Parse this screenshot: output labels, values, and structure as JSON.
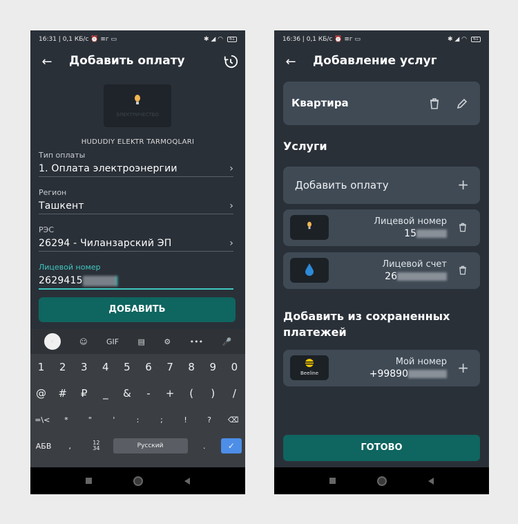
{
  "left": {
    "status": {
      "time": "16:31 | 0,1 КБ/с ⏰ ≡г ▭",
      "icons": "✱ ◢ ◠",
      "battery": "61"
    },
    "title": "Добавить оплату",
    "logo_text": "ЭЛЕКТРИЧЕСТВО",
    "company": "HUDUDIY ELEKTR TARMOQLARI",
    "fields": [
      {
        "label": "Тип оплаты",
        "value": "1. Оплата электроэнергии"
      },
      {
        "label": "Регион",
        "value": "Ташкент"
      },
      {
        "label": "РЭС",
        "value": "26294 - Чиланзарский ЭП"
      },
      {
        "label": "Лицевой номер",
        "value": "2629415"
      }
    ],
    "add_button": "ДОБАВИТЬ",
    "keyboard": {
      "toolbar": [
        "‹",
        "☺",
        "GIF",
        "▤",
        "⚙",
        "•••",
        "🎤"
      ],
      "row1": [
        "1",
        "2",
        "3",
        "4",
        "5",
        "6",
        "7",
        "8",
        "9",
        "0"
      ],
      "row2": [
        "@",
        "#",
        "₽",
        "_",
        "&",
        "-",
        "+",
        "(",
        ")",
        "/"
      ],
      "row3": [
        "=\\<",
        "*",
        "\"",
        "'",
        ":",
        ";",
        "!",
        "?",
        "⌫"
      ],
      "row4": {
        "abc": "АБВ",
        "comma": ",",
        "num": "12\n34",
        "space": "Русский",
        "dot": ".",
        "enter": "✓"
      }
    }
  },
  "right": {
    "status": {
      "time": "16:36 | 0,1 КБ/с ⏰ ≡г ▭",
      "icons": "✱ ◢ ◠",
      "battery": "61"
    },
    "title": "Добавление услуг",
    "group_name": "Квартира",
    "services_title": "Услуги",
    "add_payment": "Добавить оплату",
    "services": [
      {
        "label": "Лицевой номер",
        "value": "15"
      },
      {
        "label": "Лицевой счет",
        "value": "26"
      }
    ],
    "saved_title": "Добавить из сохраненных платежей",
    "saved": {
      "label": "Мой номер",
      "value": "+99890",
      "logo": "Beeline"
    },
    "done_button": "ГОТОВО"
  }
}
